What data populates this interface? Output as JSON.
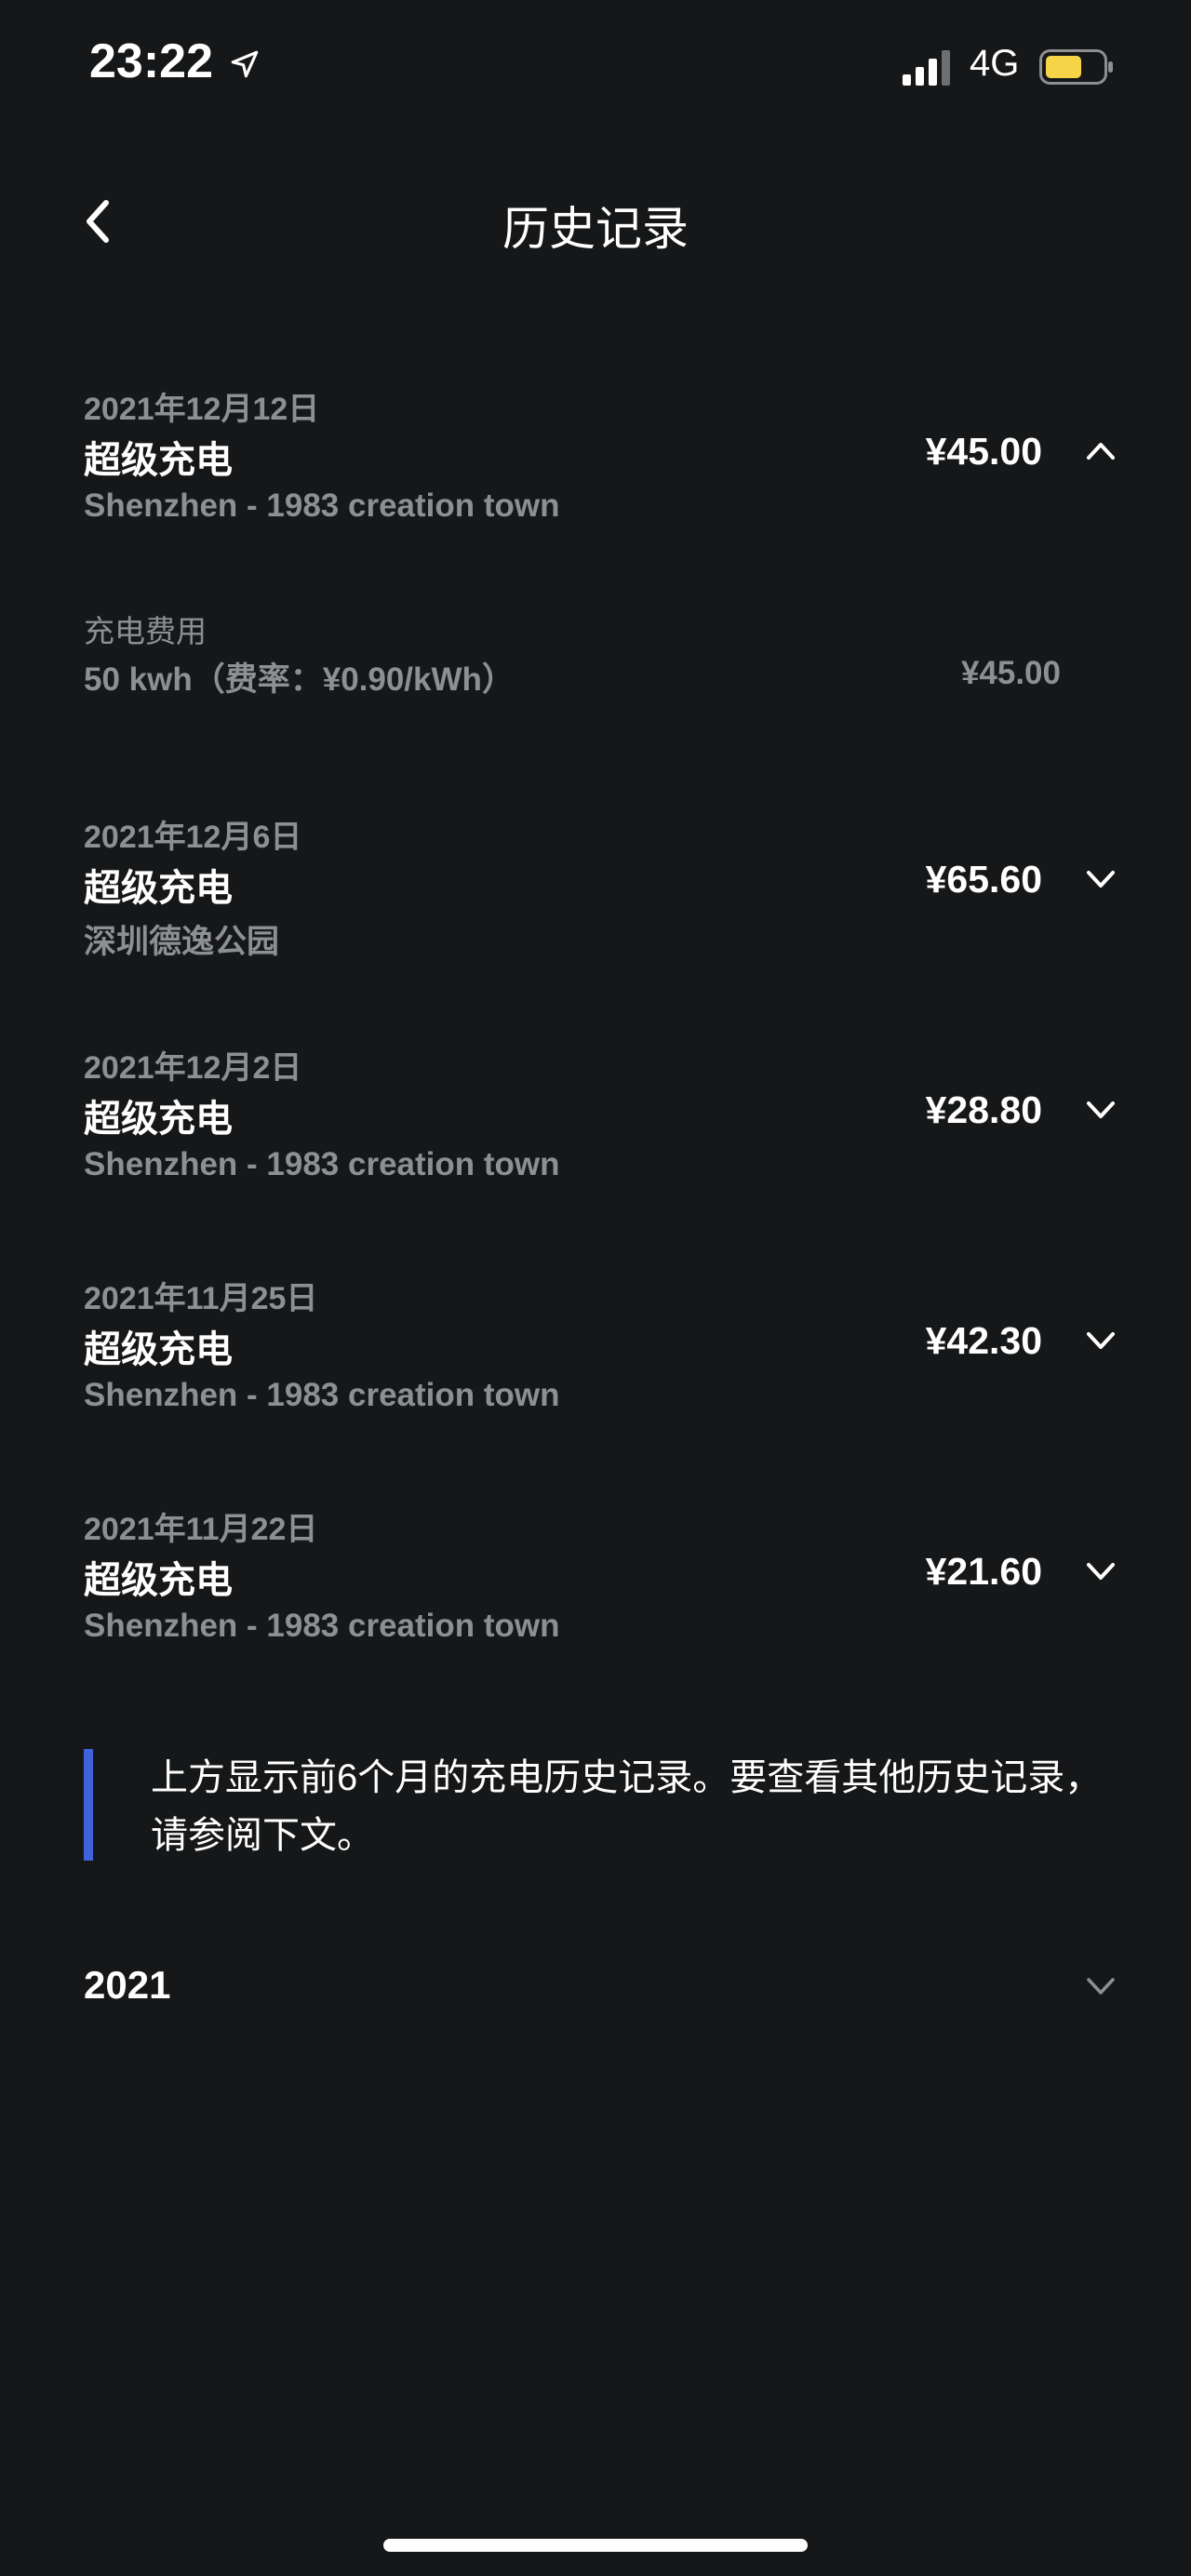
{
  "status_bar": {
    "time": "23:22",
    "network": "4G",
    "battery_color": "#f5d547"
  },
  "header": {
    "title": "历史记录"
  },
  "entries": [
    {
      "date": "2021年12月12日",
      "type": "超级充电",
      "location": "Shenzhen - 1983 creation town",
      "amount": "¥45.00",
      "expanded": true,
      "detail": {
        "label": "充电费用",
        "rate": "50 kwh（费率：¥0.90/kWh）",
        "amount": "¥45.00"
      }
    },
    {
      "date": "2021年12月6日",
      "type": "超级充电",
      "location": "深圳德逸公园",
      "amount": "¥65.60",
      "expanded": false
    },
    {
      "date": "2021年12月2日",
      "type": "超级充电",
      "location": "Shenzhen - 1983 creation town",
      "amount": "¥28.80",
      "expanded": false
    },
    {
      "date": "2021年11月25日",
      "type": "超级充电",
      "location": "Shenzhen - 1983 creation town",
      "amount": "¥42.30",
      "expanded": false
    },
    {
      "date": "2021年11月22日",
      "type": "超级充电",
      "location": "Shenzhen - 1983 creation town",
      "amount": "¥21.60",
      "expanded": false
    }
  ],
  "notice": {
    "text": "上方显示前6个月的充电历史记录。要查看其他历史记录，请参阅下文。",
    "accent_color": "#3e63dd"
  },
  "year_section": {
    "label": "2021"
  }
}
